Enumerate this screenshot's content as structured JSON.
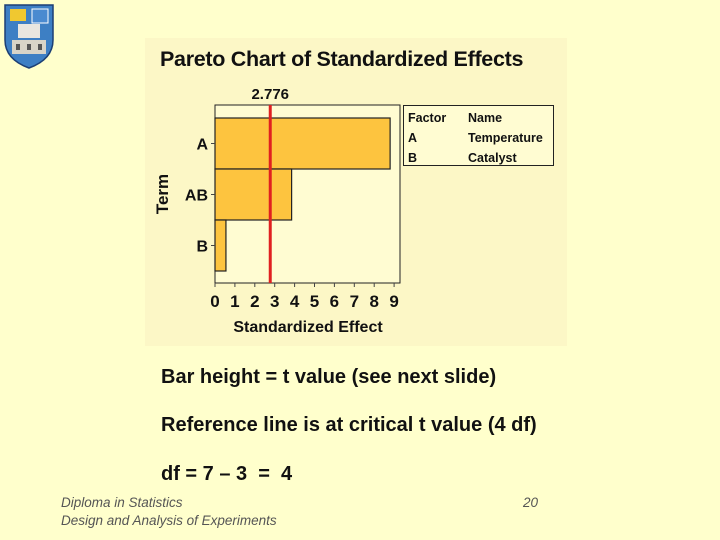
{
  "slide": {
    "logo": "university-crest-icon",
    "bullets": [
      "Bar height = t value (see next slide)",
      "Reference line is at critical t value (4 df)",
      "df = 7 – 3  =  4"
    ],
    "footer": {
      "line1": "Diploma in Statistics",
      "line2": "Design and Analysis of Experiments",
      "page_number": "20"
    },
    "background_color": "#ffffcc"
  },
  "legend": {
    "header": [
      "Factor",
      "Name"
    ],
    "rows": [
      [
        "A",
        "Temperature"
      ],
      [
        "B",
        "Catalyst"
      ]
    ]
  },
  "chart_data": {
    "type": "bar",
    "orientation": "horizontal",
    "title": "Pareto Chart of Standardized Effects",
    "xlabel": "Standardized Effect",
    "ylabel": "Term",
    "categories": [
      "A",
      "AB",
      "B"
    ],
    "values": [
      8.8,
      3.85,
      0.55
    ],
    "xlim": [
      0,
      9.3
    ],
    "xticks": [
      0,
      1,
      2,
      3,
      4,
      5,
      6,
      7,
      8,
      9
    ],
    "reference_line": {
      "value": 2.776,
      "label": "2.776",
      "color": "#e02020"
    },
    "bar_color": "#fdc43f",
    "grid": false,
    "legend_position": "right"
  }
}
